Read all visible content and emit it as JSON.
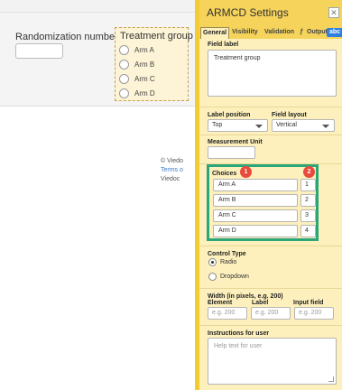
{
  "form": {
    "randomization_label": "Randomization number",
    "treatment_group": {
      "title": "Treatment group",
      "options": [
        "Arm A",
        "Arm B",
        "Arm C",
        "Arm D"
      ]
    }
  },
  "footer": {
    "line1": "© Viedo",
    "line2": "Terms o",
    "line3": "Viedoc"
  },
  "panel": {
    "title": "ARMCD Settings",
    "close_label": "✕",
    "tabs": [
      "General",
      "Visibility",
      "Validation",
      "ƒ",
      "Output",
      "abc ▾"
    ],
    "field_label": {
      "label": "Field label",
      "value": "Treatment group"
    },
    "label_position": {
      "label": "Label position",
      "value": "Top"
    },
    "field_layout": {
      "label": "Field layout",
      "value": "Vertical"
    },
    "measurement_unit": {
      "label": "Measurement Unit",
      "value": ""
    },
    "choices": {
      "label": "Choices",
      "badge1": "1",
      "badge2": "2",
      "items": [
        {
          "name": "Arm A",
          "value": "1"
        },
        {
          "name": "Arm B",
          "value": "2"
        },
        {
          "name": "Arm C",
          "value": "3"
        },
        {
          "name": "Arm D",
          "value": "4"
        }
      ]
    },
    "control_type": {
      "label": "Control Type",
      "options": [
        "Radio",
        "Dropdown"
      ],
      "selected": "Radio"
    },
    "width": {
      "label": "Width (in pixels, e.g. 200)",
      "element_label": "Element",
      "label_label": "Label",
      "input_label": "Input field",
      "placeholder": "e.g. 200"
    },
    "instructions": {
      "label": "Instructions for user",
      "placeholder": "Help text for user"
    }
  },
  "colors": {
    "panel_bg": "#fdf0bd",
    "panel_header": "#f6d35a",
    "highlight_border": "#2aa678",
    "badge": "#e84b3c",
    "abc_tab": "#2f7fe0"
  }
}
